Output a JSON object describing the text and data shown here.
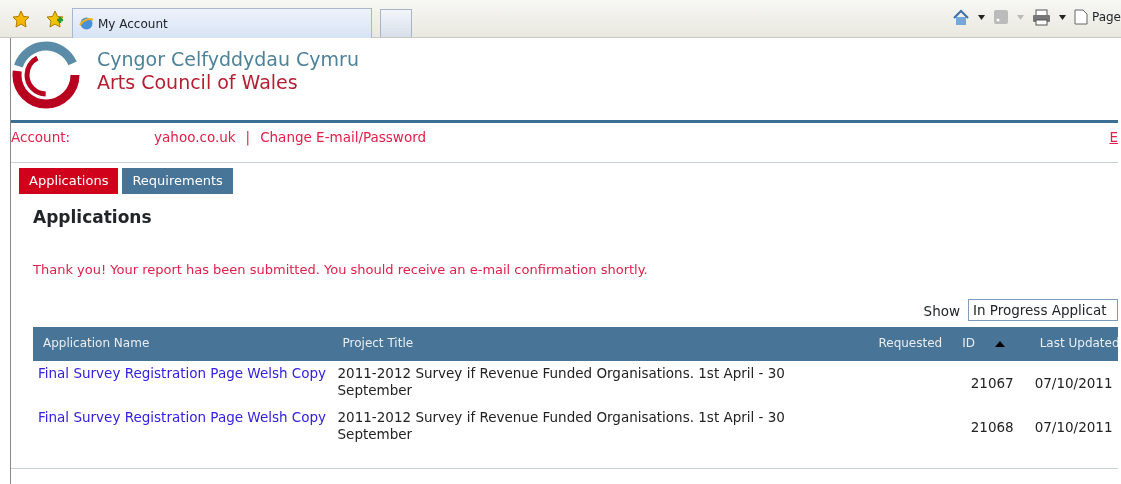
{
  "browser": {
    "tab_title": "My Account",
    "page_menu": "Page"
  },
  "header": {
    "welsh_name": "Cyngor Celfyddydau Cymru",
    "english_name": "Arts Council of Wales"
  },
  "account": {
    "label": "Account:",
    "email": "yahoo.co.uk",
    "separator": "|",
    "change_link": "Change E-mail/Password",
    "right_link": "E"
  },
  "tabs": [
    {
      "label": "Applications",
      "selected": true
    },
    {
      "label": "Requirements",
      "selected": false
    }
  ],
  "heading": "Applications",
  "message": "Thank you! Your report has been submitted. You should receive an e-mail confirmation shortly.",
  "filter": {
    "label": "Show",
    "value": "In Progress Applicat"
  },
  "table": {
    "columns": [
      {
        "label": "Application Name",
        "sorted": false
      },
      {
        "label": "Project Title",
        "sorted": false
      },
      {
        "label": "Requested",
        "sorted": false
      },
      {
        "label": "ID",
        "sorted": true
      },
      {
        "label": "Last Updated",
        "sorted": false
      }
    ],
    "rows": [
      {
        "application_name": "Final Survey Registration Page Welsh Copy",
        "project_title": "2011-2012 Survey if Revenue Funded Organisations. 1st April - 30 September",
        "id": "21067",
        "last_updated": "07/10/2011"
      },
      {
        "application_name": "Final Survey Registration Page Welsh Copy",
        "project_title": "2011-2012 Survey if Revenue Funded Organisations. 1st April - 30 September",
        "id": "21068",
        "last_updated": "07/10/2011"
      }
    ]
  }
}
